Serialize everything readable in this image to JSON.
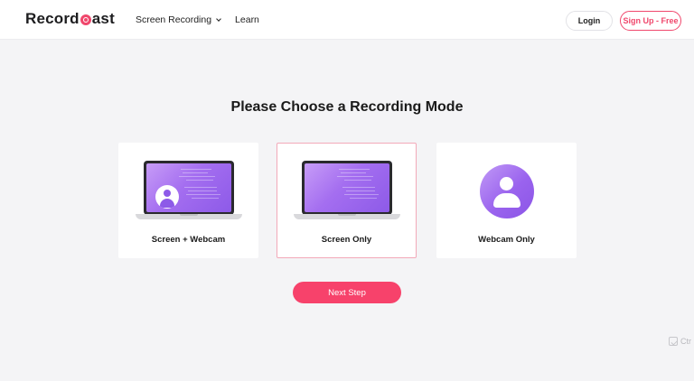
{
  "brand": {
    "logo_text_before": "Record",
    "logo_text_after": "ast"
  },
  "nav": {
    "items": [
      {
        "label": "Screen Recording"
      },
      {
        "label": "Learn"
      }
    ]
  },
  "header": {
    "login_label": "Login",
    "signup_label": "Sign Up - Free"
  },
  "main": {
    "title": "Please Choose a Recording Mode",
    "modes": [
      {
        "label": "Screen + Webcam",
        "icon": "laptop-webcam-icon",
        "selected": false
      },
      {
        "label": "Screen Only",
        "icon": "laptop-icon",
        "selected": true
      },
      {
        "label": "Webcam Only",
        "icon": "webcam-avatar-icon",
        "selected": false
      }
    ],
    "next_label": "Next Step"
  },
  "corner": {
    "label": "Ctr"
  },
  "colors": {
    "accent": "#f7426b",
    "purple": "#9a63ee",
    "background": "#f4f4f6"
  }
}
